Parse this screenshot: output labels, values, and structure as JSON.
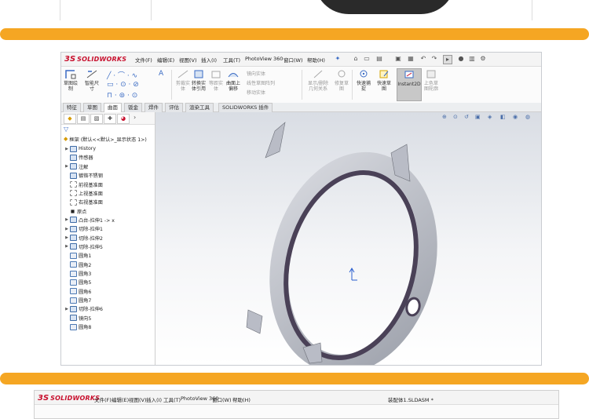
{
  "app": {
    "name_prefix": "3S",
    "name": "SOLIDWORKS"
  },
  "menu": [
    "文件(F)",
    "编辑(E)",
    "视图(V)",
    "插入(I)",
    "工具(T)",
    "PhotoView 360",
    "窗口(W)",
    "帮助(H)"
  ],
  "ribbon": {
    "sketch": "草图绘\n制",
    "smart_dim": "智能尺\n寸",
    "convert": "转换实\n体引用",
    "offset_entities": "等距实\n体",
    "offset_surface": "曲面上\n偏移",
    "mirror": "镜向实体",
    "linear_pattern": "线性草图阵列",
    "move": "移动实体",
    "display_relations": "显示/删除\n几何关系",
    "repair": "修复草\n图",
    "quick_snap": "快速捕\n捉",
    "rapid_sketch": "快速草\n图",
    "instant2d": "Instant2D",
    "shaded_sketch": "上色草\n图轮廓"
  },
  "tabs": [
    "特征",
    "草图",
    "曲面",
    "钣金",
    "焊件",
    "评估",
    "渲染工具",
    "SOLIDWORKS 插件"
  ],
  "active_tab": "曲面",
  "tree": {
    "root": "框架  (默认<<默认>_显示状态 1>)",
    "items": [
      {
        "label": "History",
        "arrow": "▶",
        "kind": "feat"
      },
      {
        "label": "传感器",
        "arrow": "",
        "kind": "feat"
      },
      {
        "label": "注解",
        "arrow": "▶",
        "kind": "feat"
      },
      {
        "label": "镀铬不锈钢",
        "arrow": "",
        "kind": "feat"
      },
      {
        "label": "前视基准面",
        "arrow": "",
        "kind": "plane"
      },
      {
        "label": "上视基准面",
        "arrow": "",
        "kind": "plane"
      },
      {
        "label": "右视基准面",
        "arrow": "",
        "kind": "plane"
      },
      {
        "label": "原点",
        "arrow": "",
        "kind": "pt"
      },
      {
        "label": "凸台-拉伸1 -> x",
        "arrow": "▶",
        "kind": "feat"
      },
      {
        "label": "切除-拉伸1",
        "arrow": "▶",
        "kind": "feat"
      },
      {
        "label": "切除-拉伸2",
        "arrow": "▶",
        "kind": "feat"
      },
      {
        "label": "切除-拉伸5",
        "arrow": "▶",
        "kind": "feat"
      },
      {
        "label": "圆角1",
        "arrow": "",
        "kind": "fillet"
      },
      {
        "label": "圆角2",
        "arrow": "",
        "kind": "fillet"
      },
      {
        "label": "圆角3",
        "arrow": "",
        "kind": "fillet"
      },
      {
        "label": "圆角5",
        "arrow": "",
        "kind": "fillet"
      },
      {
        "label": "圆角6",
        "arrow": "",
        "kind": "fillet"
      },
      {
        "label": "圆角7",
        "arrow": "",
        "kind": "fillet"
      },
      {
        "label": "切除-拉伸6",
        "arrow": "▶",
        "kind": "feat"
      },
      {
        "label": "镜向5",
        "arrow": "",
        "kind": "feat"
      },
      {
        "label": "圆角8",
        "arrow": "",
        "kind": "fillet"
      }
    ]
  },
  "bottom": {
    "menu": [
      "文件(F)",
      "编辑(E)",
      "视图(V)",
      "插入(I)",
      "工具(T)",
      "PhotoView 360",
      "窗口(W)",
      "帮助(H)"
    ],
    "doc_title": "装配体1.SLDASM *"
  },
  "colors": {
    "accent": "#f5a623",
    "brand": "#c8102e",
    "model_top": "#b9bcc6",
    "model_side": "#4a4157"
  }
}
